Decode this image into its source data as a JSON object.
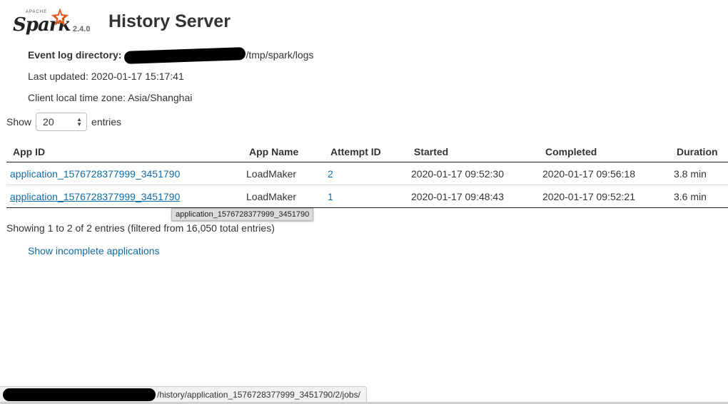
{
  "header": {
    "logo_text": "Spark",
    "logo_apache": "APACHE",
    "version": "2.4.0",
    "title": "History Server"
  },
  "info": {
    "event_log_label": "Event log directory:",
    "event_log_value": "/tmp/spark/logs",
    "last_updated": "Last updated: 2020-01-17 15:17:41",
    "timezone": "Client local time zone: Asia/Shanghai"
  },
  "entries": {
    "show_label": "Show",
    "selected": "20",
    "entries_label": "entries"
  },
  "table": {
    "headers": [
      "App ID",
      "App Name",
      "Attempt ID",
      "Started",
      "Completed",
      "Duration"
    ],
    "rows": [
      {
        "app_id": "application_1576728377999_3451790",
        "app_name": "LoadMaker",
        "attempt": "2",
        "started": "2020-01-17 09:52:30",
        "completed": "2020-01-17 09:56:18",
        "duration": "3.8 min"
      },
      {
        "app_id": "application_1576728377999_3451790",
        "app_name": "LoadMaker",
        "attempt": "1",
        "started": "2020-01-17 09:48:43",
        "completed": "2020-01-17 09:52:21",
        "duration": "3.6 min"
      }
    ]
  },
  "tooltip": "application_1576728377999_3451790",
  "footer": {
    "showing": "Showing 1 to 2 of 2 entries (filtered from 16,050 total entries)",
    "incomplete_link": "Show incomplete applications"
  },
  "statusbar": {
    "url": "/history/application_1576728377999_3451790/2/jobs/"
  },
  "colors": {
    "link": "#0f6ba5",
    "logo_star": "#e25a1c"
  }
}
